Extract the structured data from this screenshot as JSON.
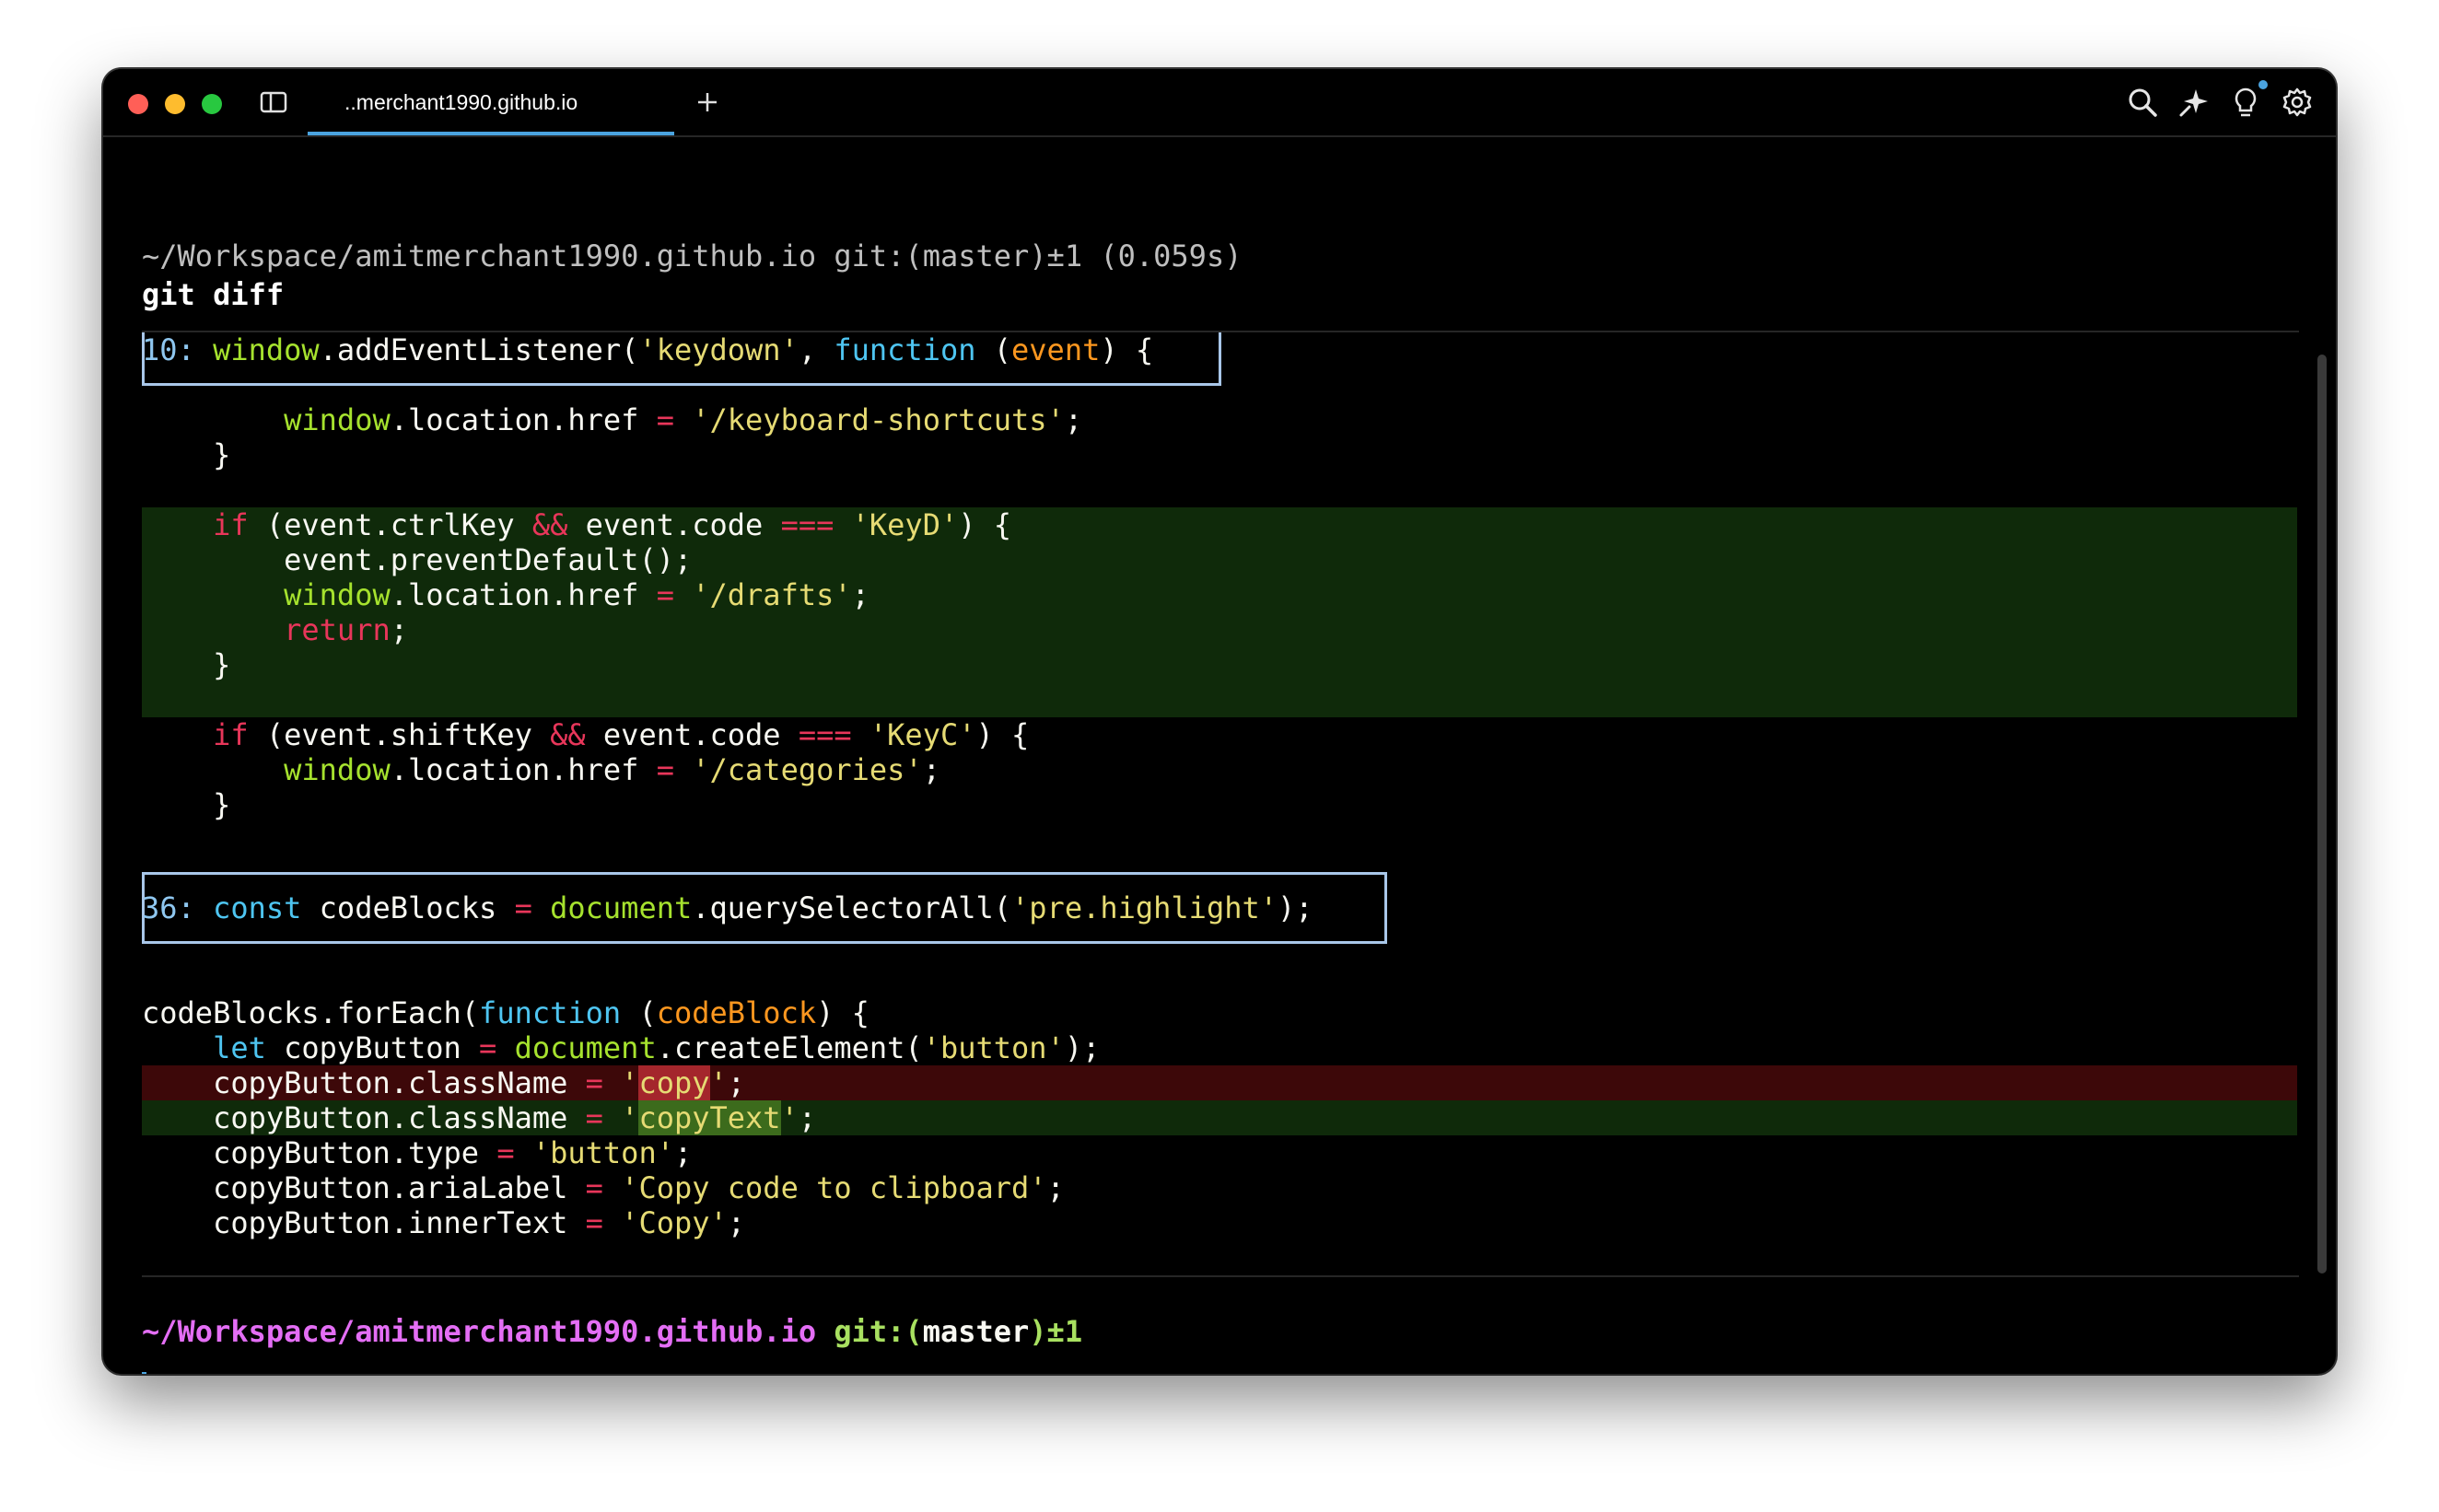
{
  "window": {
    "tab_title": "..merchant1990.github.io",
    "icons": [
      "sidebar-panel-icon",
      "plus-icon",
      "search-icon",
      "ai-sparkle-icon",
      "lightbulb-icon",
      "gear-icon"
    ]
  },
  "terminal": {
    "prev_prompt": "~/Workspace/amitmerchant1990.github.io git:(master)±1 (0.059s)",
    "command": "git diff",
    "diff": {
      "hunk1": {
        "line_no": "10:",
        "header": "window.addEventListener('keydown', function (event) {",
        "lines": {
          "l1": "        window.location.href = '/keyboard-shortcuts';",
          "l2": "    }",
          "a1": "    if (event.ctrlKey && event.code === 'KeyD') {",
          "a2": "        event.preventDefault();",
          "a3": "        window.location.href = '/drafts';",
          "a4": "        return;",
          "a5": "    }",
          "l3": "    if (event.shiftKey && event.code === 'KeyC') {",
          "l4": "        window.location.href = '/categories';",
          "l5": "    }"
        }
      },
      "hunk2": {
        "line_no": "36:",
        "header": "const codeBlocks = document.querySelectorAll('pre.highlight');",
        "lines": {
          "c1": "codeBlocks.forEach(function (codeBlock) {",
          "c2": "    let copyButton = document.createElement('button');",
          "removed": "    copyButton.className = 'copy';",
          "added": "    copyButton.className = 'copyText';",
          "c3": "    copyButton.type = 'button';",
          "c4": "    copyButton.ariaLabel = 'Copy code to clipboard';",
          "c5": "    copyButton.innerText = 'Copy';"
        }
      }
    },
    "prompt": {
      "path": "~/Workspace/amitmerchant1990.github.io",
      "git_label": "git:(",
      "branch": "master",
      "git_close": ")",
      "status": "±1"
    }
  },
  "colors": {
    "background": "#000000",
    "accent": "#4aa3df",
    "added_bg": "#0f2a0a",
    "removed_bg": "#3d0809",
    "keyword": "#e8365a",
    "string": "#e6db74",
    "function_kw": "#4ec5f1"
  }
}
